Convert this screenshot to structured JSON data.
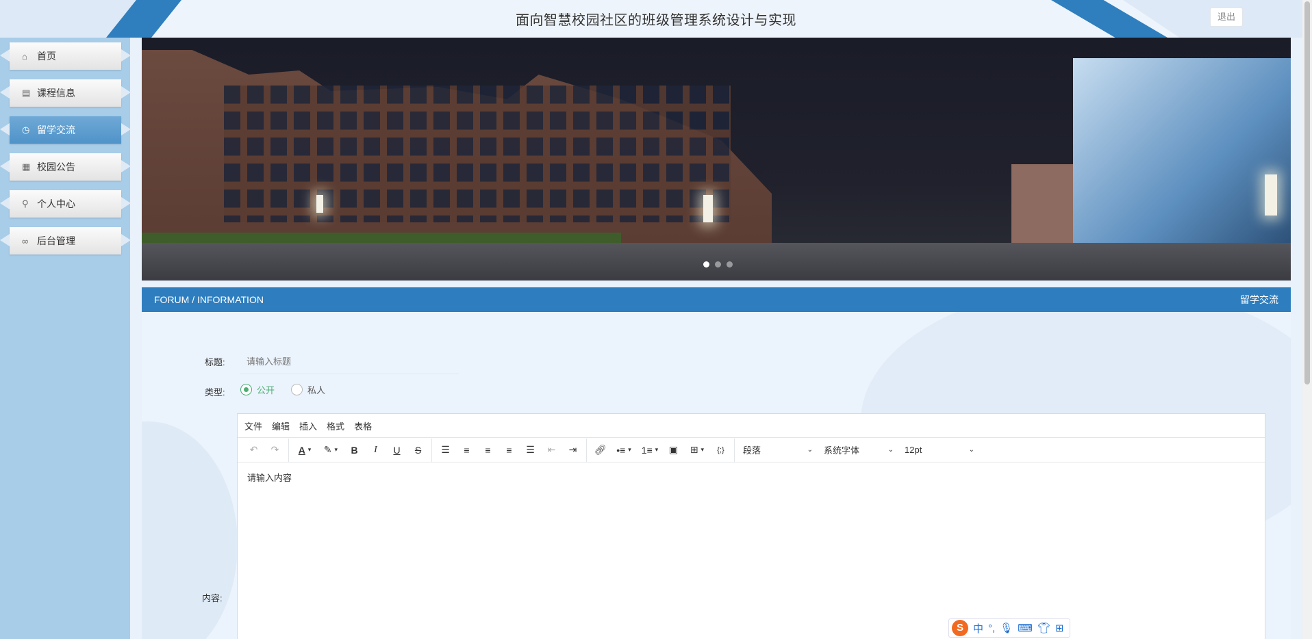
{
  "header": {
    "title": "面向智慧校园社区的班级管理系统设计与实现",
    "logout_label": "退出"
  },
  "sidebar": {
    "items": [
      {
        "label": "首页",
        "icon": "home-icon",
        "glyph": "⌂"
      },
      {
        "label": "课程信息",
        "icon": "document-icon",
        "glyph": "▤"
      },
      {
        "label": "留学交流",
        "icon": "clock-icon",
        "glyph": "◷"
      },
      {
        "label": "校园公告",
        "icon": "notice-icon",
        "glyph": "▦"
      },
      {
        "label": "个人中心",
        "icon": "user-icon",
        "glyph": "⚲"
      },
      {
        "label": "后台管理",
        "icon": "link-icon",
        "glyph": "∞"
      }
    ],
    "active_index": 2
  },
  "banner": {
    "slides": 3,
    "active_slide": 0
  },
  "section": {
    "left": "FORUM / INFORMATION",
    "right": "留学交流"
  },
  "form": {
    "title_label": "标题:",
    "title_placeholder": "请输入标题",
    "type_label": "类型:",
    "type_options": [
      "公开",
      "私人"
    ],
    "type_selected": "公开",
    "content_label": "内容:"
  },
  "editor": {
    "menus": [
      "文件",
      "编辑",
      "插入",
      "格式",
      "表格"
    ],
    "block_format": "段落",
    "font_family": "系统字体",
    "font_size": "12pt",
    "placeholder_text": "请输入内容"
  },
  "ime": {
    "mode": "中",
    "logo": "S"
  },
  "colors": {
    "accent": "#2e7ebf",
    "sidebar_bg": "#a8cde9",
    "active_nav": "#4f93c9",
    "radio_green": "#4cae72"
  }
}
